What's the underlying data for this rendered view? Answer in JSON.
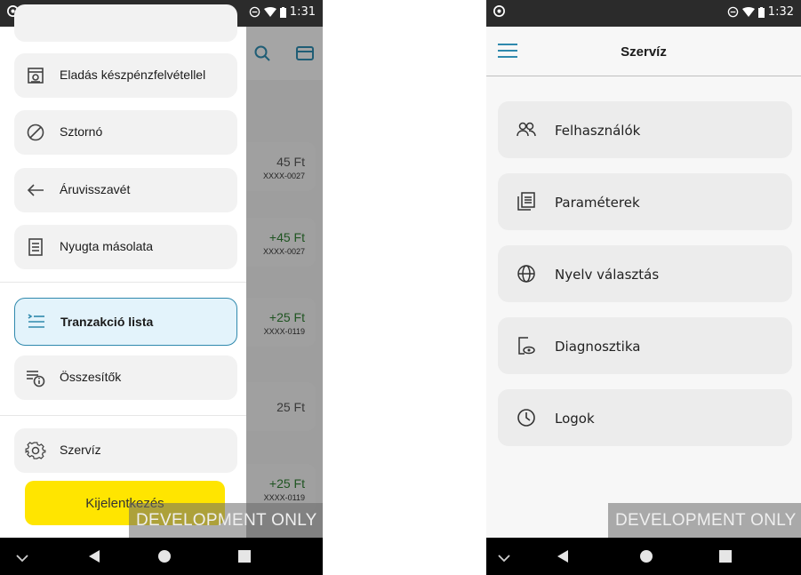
{
  "left": {
    "status": {
      "time": "1:31"
    },
    "background": {
      "rows": [
        {
          "amount": "45 Ft",
          "sub": "XXXX-0027",
          "color": "#555555"
        },
        {
          "amount": "+45 Ft",
          "sub": "XXXX-0027",
          "color": "#2e7d32"
        },
        {
          "amount": "+25 Ft",
          "sub": "XXXX-0119",
          "color": "#2e7d32"
        },
        {
          "amount": "25 Ft",
          "sub": "",
          "color": "#555555"
        },
        {
          "amount": "+25 Ft",
          "sub": "XXXX-0119",
          "color": "#2e7d32"
        }
      ]
    },
    "drawer": {
      "items": [
        {
          "label": "Eladás készpénzfelvétellel",
          "icon": "cash-register-icon"
        },
        {
          "label": "Sztornó",
          "icon": "cancel-circle-icon"
        },
        {
          "label": "Áruvisszavét",
          "icon": "arrow-left-icon"
        },
        {
          "label": "Nyugta másolata",
          "icon": "receipt-icon"
        },
        {
          "label": "Tranzakció lista",
          "icon": "list-icon",
          "active": true
        },
        {
          "label": "Összesítők",
          "icon": "summary-info-icon"
        },
        {
          "label": "Szervíz",
          "icon": "gear-icon"
        }
      ],
      "logout_label": "Kijelentkezés"
    },
    "dev_banner": "DEVELOPMENT ONLY"
  },
  "right": {
    "status": {
      "time": "1:32"
    },
    "title": "Szervíz",
    "items": [
      {
        "label": "Felhasználók",
        "icon": "users-icon"
      },
      {
        "label": "Paraméterek",
        "icon": "parameters-icon"
      },
      {
        "label": "Nyelv választás",
        "icon": "globe-icon"
      },
      {
        "label": "Diagnosztika",
        "icon": "diagnostics-icon"
      },
      {
        "label": "Logok",
        "icon": "clock-icon"
      }
    ],
    "dev_banner": "DEVELOPMENT ONLY"
  },
  "colors": {
    "accent": "#2f89ad",
    "logout": "#ffe500",
    "status_bar": "#2b2b2b"
  }
}
